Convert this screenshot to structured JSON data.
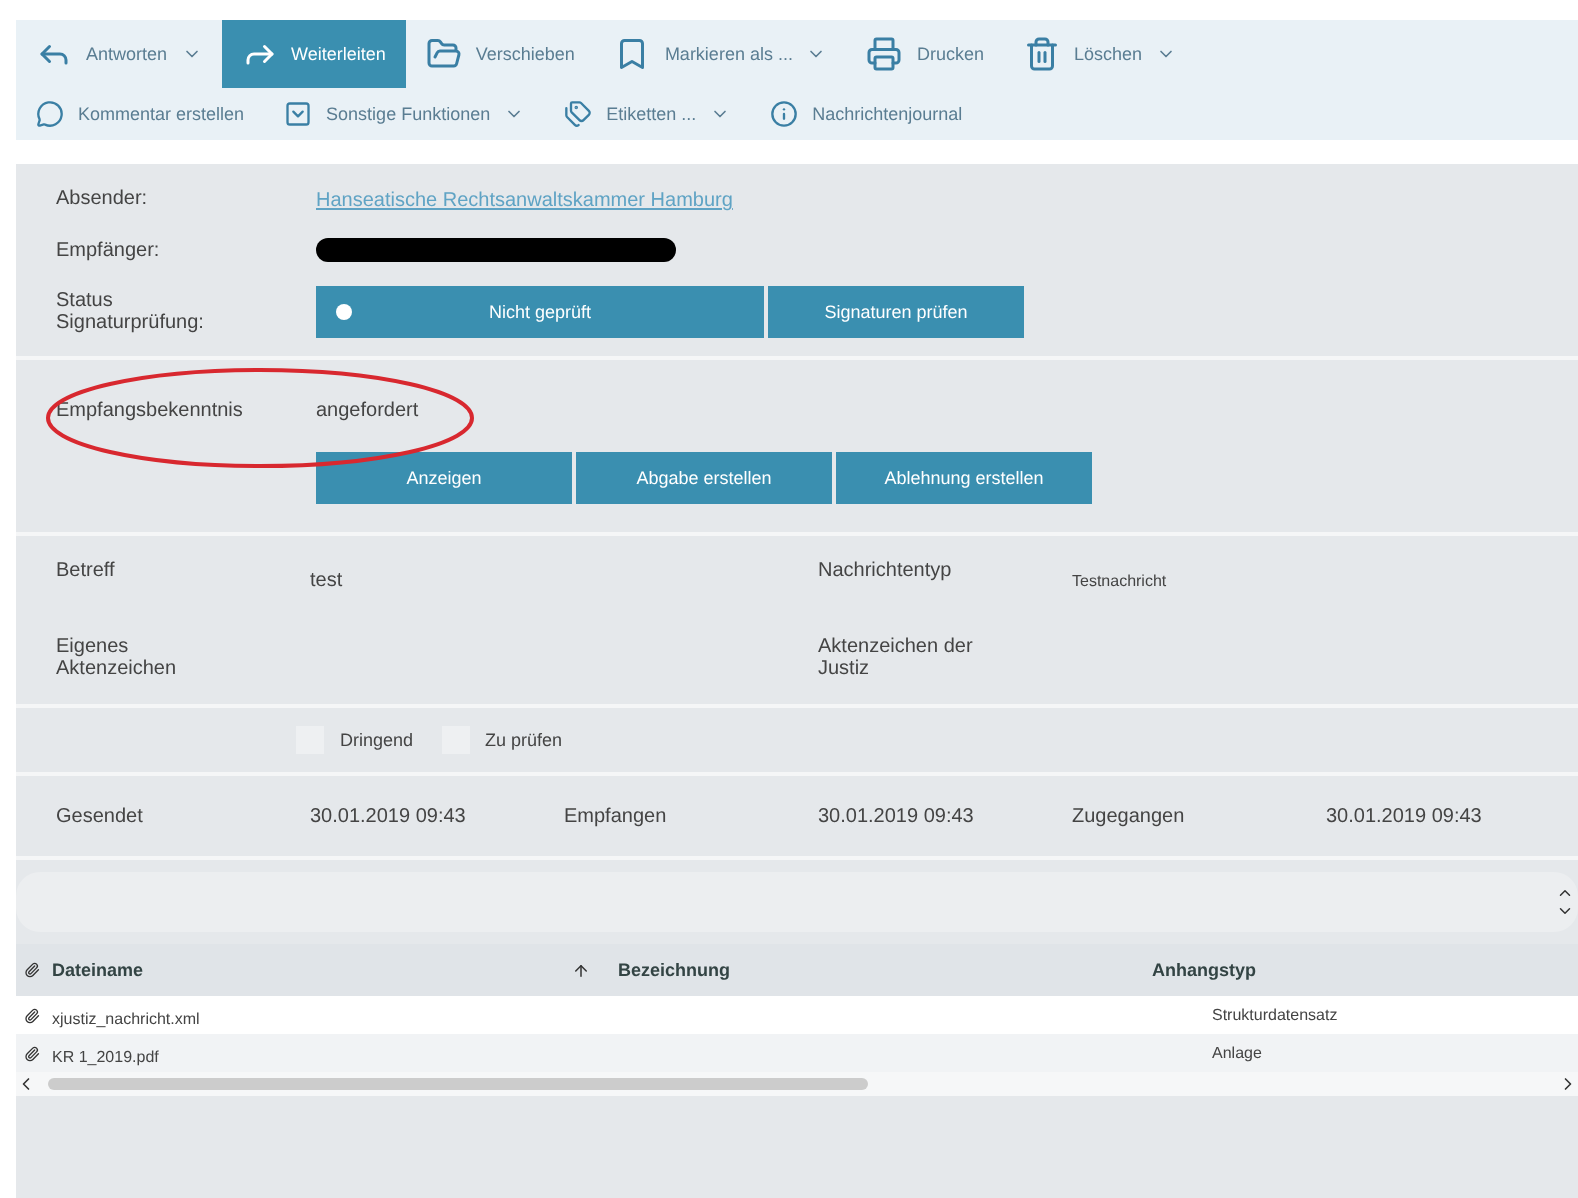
{
  "toolbar": {
    "primary": [
      {
        "kind": "reply",
        "label": "Antworten",
        "dropdown": true,
        "selected": false
      },
      {
        "kind": "forward",
        "label": "Weiterleiten",
        "dropdown": false,
        "selected": true
      },
      {
        "kind": "move",
        "label": "Verschieben",
        "dropdown": false,
        "selected": false
      },
      {
        "kind": "mark",
        "label": "Markieren als ...",
        "dropdown": true,
        "selected": false
      },
      {
        "kind": "print",
        "label": "Drucken",
        "dropdown": false,
        "selected": false
      },
      {
        "kind": "delete",
        "label": "Löschen",
        "dropdown": true,
        "selected": false
      }
    ],
    "secondary": [
      {
        "kind": "comment",
        "label": "Kommentar erstellen",
        "dropdown": false,
        "selected": false
      },
      {
        "kind": "more",
        "label": "Sonstige Funktionen",
        "dropdown": true,
        "selected": false
      },
      {
        "kind": "labels",
        "label": "Etiketten ...",
        "dropdown": true,
        "selected": false
      },
      {
        "kind": "journal",
        "label": "Nachrichtenjournal",
        "dropdown": false,
        "selected": false
      }
    ]
  },
  "header": {
    "sender_label": "Absender:",
    "sender": "Hanseatische Rechtsanwaltskammer Hamburg",
    "recipient_label": "Empfänger:",
    "status_label": "Status Signaturprüfung:",
    "status": "Nicht geprüft",
    "check_button": "Signaturen prüfen"
  },
  "receipt": {
    "label": "Empfangsbekenntnis",
    "value": "angefordert",
    "buttons": [
      "Anzeigen",
      "Abgabe erstellen",
      "Ablehnung erstellen"
    ]
  },
  "details": [
    {
      "label": "Betreff",
      "value": "test",
      "label2": "Nachrichtentyp",
      "value2": "Testnachricht"
    },
    {
      "label": "Eigenes Aktenzeichen",
      "label2": "Aktenzeichen der Justiz"
    }
  ],
  "flags": [
    {
      "label": "Dringend",
      "checked": false
    },
    {
      "label": "Zu prüfen",
      "checked": false
    }
  ],
  "dates": [
    {
      "label": "Gesendet",
      "value": "30.01.2019 09:43"
    },
    {
      "label": "Empfangen",
      "value": "30.01.2019 09:43"
    },
    {
      "label": "Zugegangen",
      "value": "30.01.2019 09:43"
    }
  ],
  "attachments": {
    "columns": [
      "Dateiname",
      "Bezeichnung",
      "Anhangstyp"
    ],
    "rows": [
      {
        "name": "xjustiz_nachricht.xml",
        "type": "Strukturdatensatz"
      },
      {
        "name": "KR 1_2019.pdf",
        "type": "Anlage"
      }
    ]
  }
}
